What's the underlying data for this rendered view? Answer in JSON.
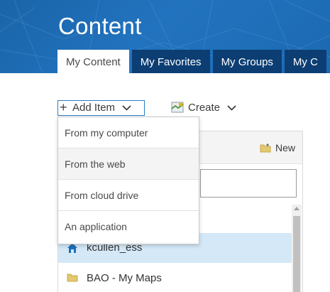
{
  "header": {
    "title": "Content",
    "tabs": [
      {
        "label": "My Content",
        "active": true
      },
      {
        "label": "My Favorites",
        "active": false
      },
      {
        "label": "My Groups",
        "active": false
      },
      {
        "label": "My C",
        "active": false
      }
    ]
  },
  "toolbar": {
    "add_item_label": "Add Item",
    "create_label": "Create"
  },
  "add_item_menu": {
    "items": [
      {
        "label": "From my computer"
      },
      {
        "label": "From the web"
      },
      {
        "label": "From cloud drive"
      },
      {
        "label": "An application"
      }
    ]
  },
  "folders_panel": {
    "new_folder_label": "New",
    "filter_value": "",
    "folders": [
      {
        "label": "kcullen_ess",
        "icon": "home-icon",
        "selected": true
      },
      {
        "label": "BAO - My Maps",
        "icon": "folder-icon",
        "selected": false
      }
    ]
  },
  "colors": {
    "header_blue": "#1e6bb5",
    "tab_dark": "#0c3e73",
    "accent_blue": "#2b7bc7",
    "selected_row": "#d4e8f7",
    "folder_yellow": "#e3c870"
  }
}
